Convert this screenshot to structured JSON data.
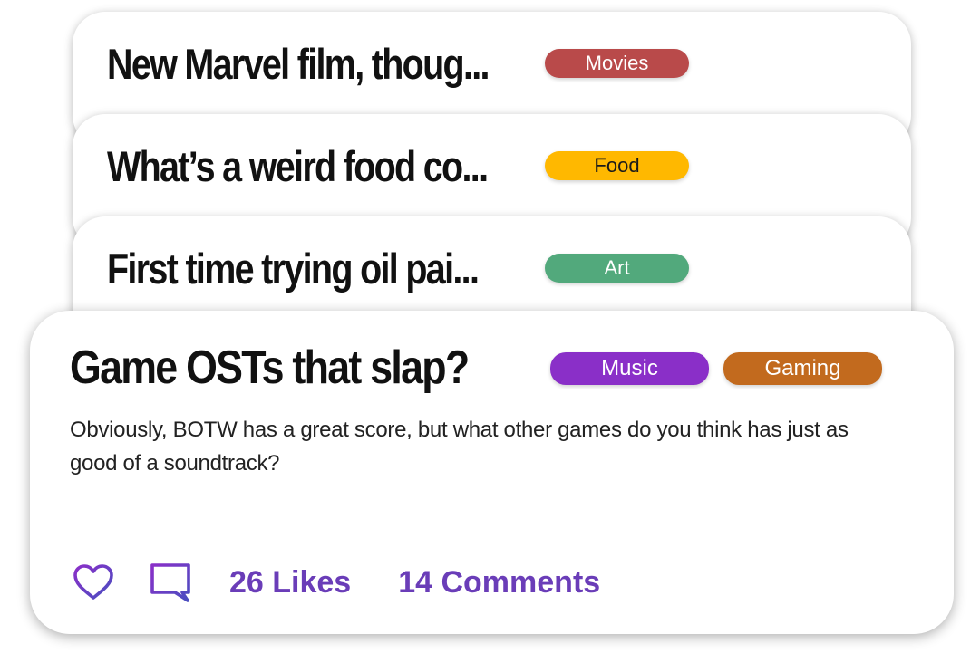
{
  "stack": [
    {
      "title": "New Marvel film, thoug...",
      "tag": "Movies",
      "tag_color": "#b94a4a",
      "tag_text_color": "#ffffff"
    },
    {
      "title": "What’s a weird food co...",
      "tag": "Food",
      "tag_color": "#ffb800",
      "tag_text_color": "#1a1a1a"
    },
    {
      "title": "First time trying oil pai...",
      "tag": "Art",
      "tag_color": "#52a97c",
      "tag_text_color": "#ffffff"
    }
  ],
  "post": {
    "title": "Game OSTs that slap?",
    "tags": [
      {
        "label": "Music",
        "color": "#8a2fc8"
      },
      {
        "label": "Gaming",
        "color": "#c26a1e"
      }
    ],
    "body": "Obviously, BOTW has a great score, but what other games do you think has just as good of a soundtrack?",
    "likes_label": "26 Likes",
    "comments_label": "14 Comments",
    "like_icon": "heart-outline-icon",
    "comment_icon": "comment-icon",
    "accent_color": "#6a3db8"
  }
}
